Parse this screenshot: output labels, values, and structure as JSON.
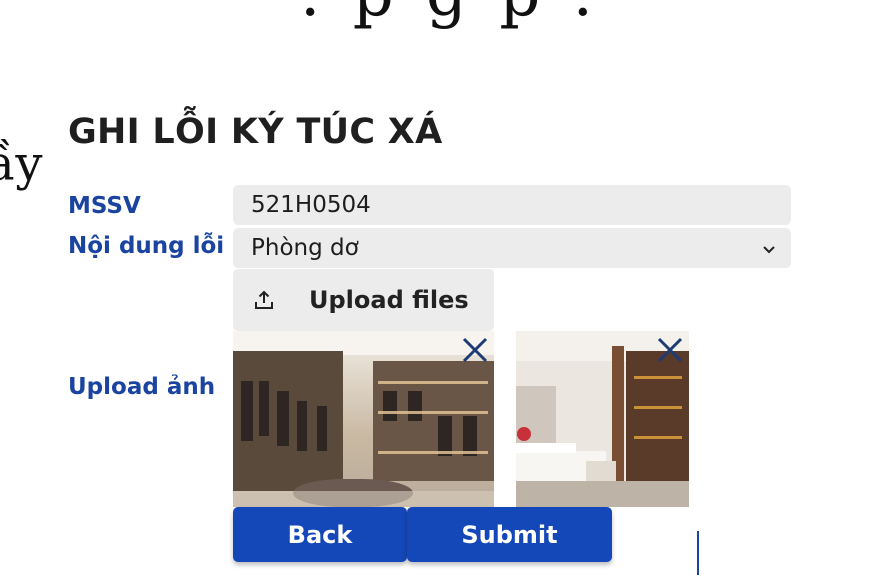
{
  "background": {
    "top_fragment": ". p  g       p .",
    "left_fragment": "ầy"
  },
  "form": {
    "title": "GHI LỖI KÝ TÚC XÁ",
    "mssv_label": "MSSV",
    "mssv_value": "521H0504",
    "noidung_label": "Nội dung lỗi",
    "noidung_selected": "Phòng dơ",
    "upload_label": "Upload ảnh",
    "upload_button": "Upload files",
    "back_button": "Back",
    "submit_button": "Submit"
  },
  "colors": {
    "accent": "#1447b8",
    "label": "#1a44a0",
    "field_bg": "#ececec"
  },
  "icons": [
    "upload-icon",
    "chevron-down-icon",
    "close-icon"
  ]
}
